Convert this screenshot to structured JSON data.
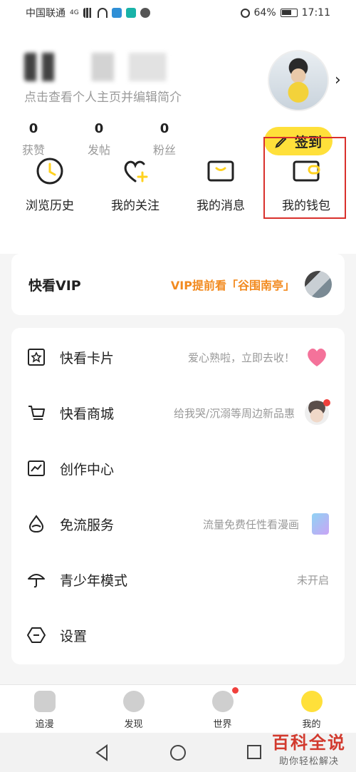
{
  "statusbar": {
    "carrier": "中国联通",
    "network": "4G",
    "battery": "64%",
    "time": "17:11"
  },
  "profile": {
    "subtitle": "点击查看个人主页并编辑简介",
    "stats": [
      {
        "value": "0",
        "label": "获赞"
      },
      {
        "value": "0",
        "label": "发帖"
      },
      {
        "value": "0",
        "label": "粉丝"
      }
    ],
    "checkin_label": "签到"
  },
  "quick_actions": [
    {
      "label": "浏览历史",
      "icon": "clock-icon"
    },
    {
      "label": "我的关注",
      "icon": "heart-plus-icon"
    },
    {
      "label": "我的消息",
      "icon": "message-icon"
    },
    {
      "label": "我的钱包",
      "icon": "wallet-icon"
    }
  ],
  "vip": {
    "title": "快看VIP",
    "promo": "VIP提前看「谷围南亭」"
  },
  "menu": [
    {
      "label": "快看卡片",
      "hint": "爱心熟啦，立即去收！",
      "icon": "card-icon"
    },
    {
      "label": "快看商城",
      "hint": "给我哭/沉溺等周边新品惠",
      "icon": "cart-icon"
    },
    {
      "label": "创作中心",
      "hint": "",
      "icon": "chart-icon"
    },
    {
      "label": "免流服务",
      "hint": "流量免费任性看漫画",
      "icon": "drop-icon"
    },
    {
      "label": "青少年模式",
      "hint": "未开启",
      "icon": "umbrella-icon"
    },
    {
      "label": "设置",
      "hint": "",
      "icon": "settings-icon"
    }
  ],
  "tabs": [
    {
      "label": "追漫"
    },
    {
      "label": "发现"
    },
    {
      "label": "世界"
    },
    {
      "label": "我的"
    }
  ],
  "watermark": {
    "title": "百科全说",
    "subtitle": "助你轻松解决"
  },
  "colors": {
    "accent": "#ffe03a",
    "promo": "#f28a1f",
    "highlight": "#d9302c"
  }
}
